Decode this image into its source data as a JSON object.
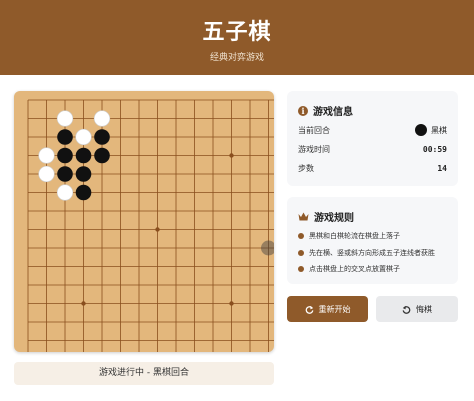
{
  "header": {
    "title": "五子棋",
    "subtitle": "经典对弈游戏"
  },
  "board": {
    "size": 15,
    "star_points": [
      [
        3,
        3
      ],
      [
        3,
        11
      ],
      [
        7,
        7
      ],
      [
        11,
        3
      ],
      [
        11,
        11
      ]
    ],
    "stones": [
      {
        "color": "white",
        "col": 2,
        "row": 1
      },
      {
        "color": "white",
        "col": 4,
        "row": 1
      },
      {
        "color": "black",
        "col": 2,
        "row": 2
      },
      {
        "color": "white",
        "col": 3,
        "row": 2
      },
      {
        "color": "black",
        "col": 4,
        "row": 2
      },
      {
        "color": "white",
        "col": 1,
        "row": 3
      },
      {
        "color": "black",
        "col": 2,
        "row": 3
      },
      {
        "color": "black",
        "col": 3,
        "row": 3
      },
      {
        "color": "black",
        "col": 4,
        "row": 3
      },
      {
        "color": "white",
        "col": 1,
        "row": 4
      },
      {
        "color": "black",
        "col": 2,
        "row": 4
      },
      {
        "color": "black",
        "col": 3,
        "row": 4
      },
      {
        "color": "white",
        "col": 2,
        "row": 5
      },
      {
        "color": "black",
        "col": 3,
        "row": 5
      }
    ],
    "hover": {
      "col": 13,
      "row": 8
    }
  },
  "status": {
    "text": "游戏进行中 - 黑棋回合"
  },
  "info": {
    "title": "游戏信息",
    "icon": "info-icon",
    "current_turn_label": "当前回合",
    "current_turn_value": "黑棋",
    "time_label": "游戏时间",
    "time_value": "00:59",
    "steps_label": "步数",
    "steps_value": "14"
  },
  "rules": {
    "title": "游戏规则",
    "icon": "crown-icon",
    "items": [
      "黑棋和白棋轮流在棋盘上落子",
      "先在横、竖或斜方向形成五子连线者获胜",
      "点击棋盘上的交叉点放置棋子"
    ]
  },
  "buttons": {
    "restart_label": "重新开始",
    "restart_icon": "refresh-icon",
    "undo_label": "悔棋",
    "undo_icon": "undo-icon"
  },
  "colors": {
    "brand": "#8f5a2a",
    "board": "#e3b77c",
    "line": "#8a4f1e"
  }
}
